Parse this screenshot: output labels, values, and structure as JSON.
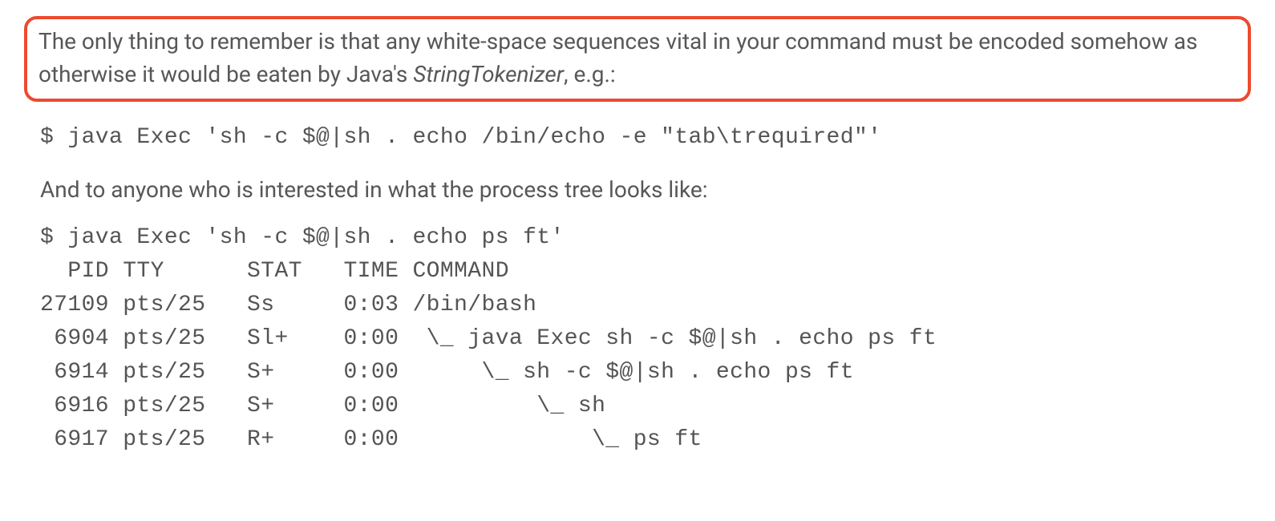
{
  "highlight": {
    "text_before_italic": "The only thing to remember is that any white-space sequences vital in your command must be encoded somehow as otherwise it would be eaten by Java's ",
    "italic": "StringTokenizer",
    "text_after_italic": ", e.g.:"
  },
  "code1": "$ java Exec 'sh -c $@|sh . echo /bin/echo -e \"tab\\trequired\"'",
  "para2": "And to anyone who is interested in what the process tree looks like:",
  "code2": "$ java Exec 'sh -c $@|sh . echo ps ft'\n  PID TTY      STAT   TIME COMMAND\n27109 pts/25   Ss     0:03 /bin/bash\n 6904 pts/25   Sl+    0:00  \\_ java Exec sh -c $@|sh . echo ps ft\n 6914 pts/25   S+     0:00      \\_ sh -c $@|sh . echo ps ft\n 6916 pts/25   S+     0:00          \\_ sh\n 6917 pts/25   R+     0:00              \\_ ps ft"
}
